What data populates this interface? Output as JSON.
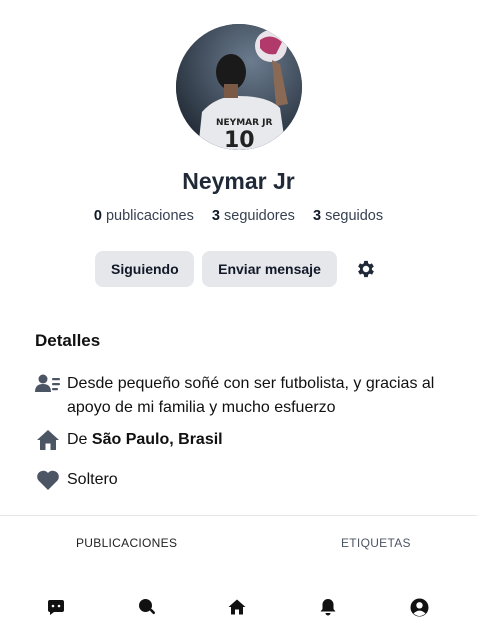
{
  "profile": {
    "name": "Neymar Jr",
    "stats": {
      "posts_count": "0",
      "posts_label": "publicaciones",
      "followers_count": "3",
      "followers_label": "seguidores",
      "following_count": "3",
      "following_label": "seguidos"
    }
  },
  "actions": {
    "following_label": "Siguiendo",
    "message_label": "Enviar mensaje",
    "settings_icon": "gear-icon"
  },
  "details": {
    "title": "Detalles",
    "bio": "Desde pequeño soñé con ser futbolista, y gracias al apoyo de mi familia y mucho esfuerzo",
    "city_prefix": "De",
    "city": "São Paulo, Brasil",
    "relationship": "Soltero",
    "icons": [
      "user-card-icon",
      "home-icon",
      "heart-icon"
    ]
  },
  "tabs": [
    {
      "label": "PUBLICACIONES"
    },
    {
      "label": "ETIQUETAS"
    }
  ],
  "bottom_nav": [
    "chat-icon",
    "search-icon",
    "home-icon",
    "bell-icon",
    "user-circle-icon"
  ],
  "colors": {
    "icon": "#4b5563",
    "button_bg": "#e5e7eb",
    "text": "#111827"
  }
}
